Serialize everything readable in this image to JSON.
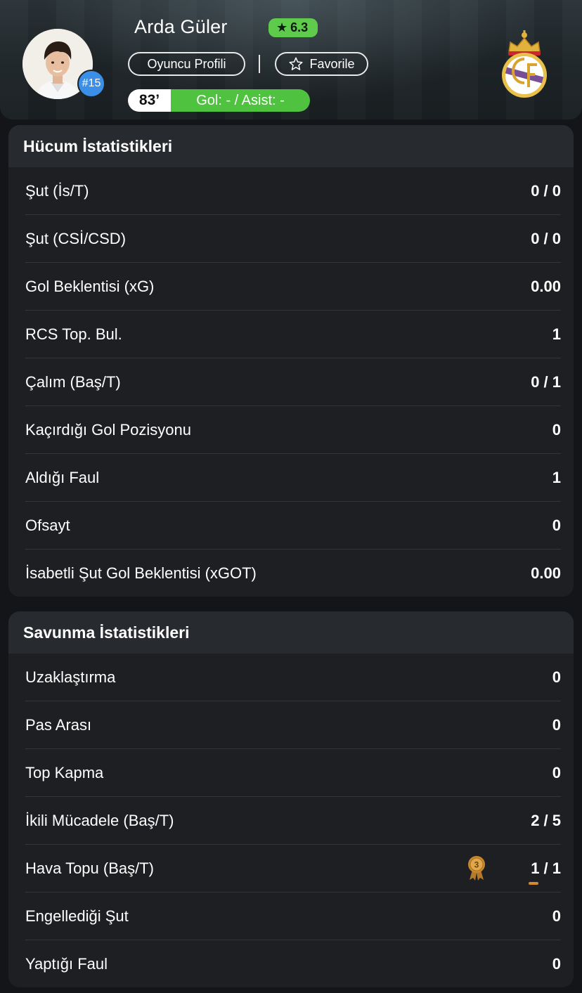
{
  "player": {
    "name": "Arda Güler",
    "jersey_number": "#15",
    "rating": "6.3",
    "rating_icon": "star-icon",
    "minute": "83’",
    "goal_assist": "Gol: - / Asist: -"
  },
  "actions": {
    "profile_label": "Oyuncu Profili",
    "favorite_label": "Favorile",
    "favorite_icon": "star-outline-icon"
  },
  "colors": {
    "rating_green": "#5fcb4c",
    "goal_green": "#4fc23f",
    "jersey_blue": "#3b8fe6",
    "card_bg": "#1e1f23",
    "card_header_bg": "#272a2f",
    "medal_gold": "#c8892f"
  },
  "attack": {
    "title": "Hücum İstatistikleri",
    "rows": [
      {
        "label": "Şut (İs/T)",
        "value": "0 / 0"
      },
      {
        "label": "Şut (CSİ/CSD)",
        "value": "0 / 0"
      },
      {
        "label": "Gol Beklentisi (xG)",
        "value": "0.00"
      },
      {
        "label": "RCS Top. Bul.",
        "value": "1"
      },
      {
        "label": "Çalım (Baş/T)",
        "value": "0 / 1"
      },
      {
        "label": "Kaçırdığı Gol Pozisyonu",
        "value": "0"
      },
      {
        "label": "Aldığı Faul",
        "value": "1"
      },
      {
        "label": "Ofsayt",
        "value": "0"
      },
      {
        "label": "İsabetli Şut Gol Beklentisi (xGOT)",
        "value": "0.00"
      }
    ]
  },
  "defense": {
    "title": "Savunma İstatistikleri",
    "rows": [
      {
        "label": "Uzaklaştırma",
        "value": "0"
      },
      {
        "label": "Pas Arası",
        "value": "0"
      },
      {
        "label": "Top Kapma",
        "value": "0"
      },
      {
        "label": "İkili Mücadele (Baş/T)",
        "value": "2 / 5"
      },
      {
        "label": "Hava Topu (Baş/T)",
        "value": "1 / 1",
        "medal": "3"
      },
      {
        "label": "Engellediği Şut",
        "value": "0"
      },
      {
        "label": "Yaptığı Faul",
        "value": "0"
      }
    ]
  }
}
